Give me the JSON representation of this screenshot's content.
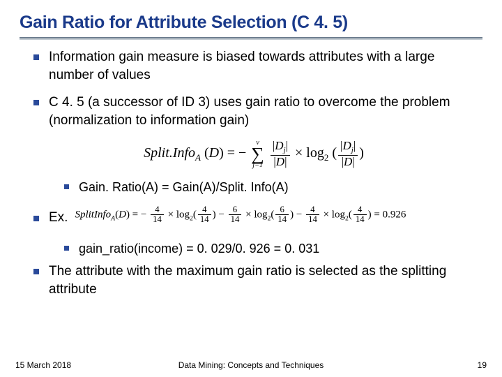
{
  "title": "Gain Ratio for Attribute Selection (C 4. 5)",
  "bullets": {
    "b1": "Information gain measure is biased towards attributes with a large number of values",
    "b2": "C 4. 5 (a successor of ID 3) uses gain ratio to overcome the problem (normalization to information gain)",
    "b3_sub": "Gain. Ratio(A) = Gain(A)/Split. Info(A)",
    "b4": "Ex.",
    "b5_sub": "gain_ratio(income) = 0. 029/0. 926 = 0. 031",
    "b6": "The attribute with the maximum gain ratio is selected as the splitting attribute"
  },
  "formula_main": {
    "lhs_name": "Split.Info",
    "lhs_sub": "A",
    "lhs_arg": "D",
    "sum_top": "v",
    "sum_bottom": "j=1",
    "frac_num": "D",
    "frac_num_sub": "j",
    "frac_den": "D",
    "log_label": "log",
    "log_base": "2"
  },
  "formula_ex": {
    "lhs_name": "SplitInfo",
    "lhs_sub": "A",
    "lhs_arg": "D",
    "t1_num": "4",
    "t1_den": "14",
    "t1_log_num": "4",
    "t1_log_den": "14",
    "t2_num": "6",
    "t2_den": "14",
    "t2_log_num": "6",
    "t2_log_den": "14",
    "t3_num": "4",
    "t3_den": "14",
    "t3_log_num": "4",
    "t3_log_den": "14",
    "result": "0.926",
    "log_label": "log",
    "log_base": "2"
  },
  "footer": {
    "date": "15 March 2018",
    "center": "Data Mining: Concepts and Techniques",
    "page": "19"
  }
}
